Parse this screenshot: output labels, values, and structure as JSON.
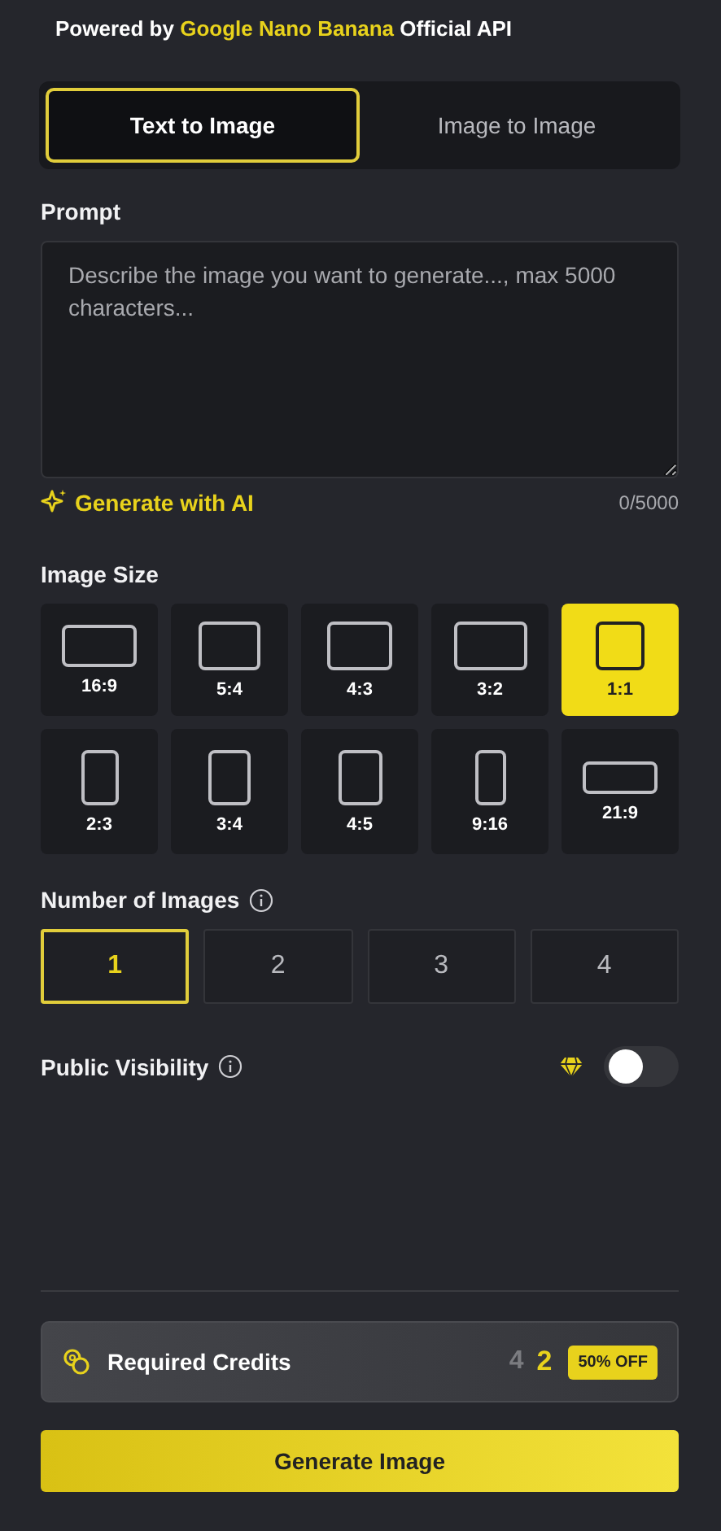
{
  "powered_by": {
    "prefix": "Powered by",
    "brand": "Google Nano Banana",
    "suffix": "Official API"
  },
  "mode_tabs": [
    {
      "label": "Text to Image",
      "selected": true
    },
    {
      "label": "Image to Image",
      "selected": false
    }
  ],
  "prompt": {
    "label": "Prompt",
    "placeholder": "Describe the image you want to generate..., max 5000 characters...",
    "generate_with_ai": "Generate with AI",
    "counter": "0/5000"
  },
  "image_size": {
    "label": "Image Size",
    "options": [
      {
        "label": "16:9",
        "selected": false
      },
      {
        "label": "5:4",
        "selected": false
      },
      {
        "label": "4:3",
        "selected": false
      },
      {
        "label": "3:2",
        "selected": false
      },
      {
        "label": "1:1",
        "selected": true
      },
      {
        "label": "2:3",
        "selected": false
      },
      {
        "label": "3:4",
        "selected": false
      },
      {
        "label": "4:5",
        "selected": false
      },
      {
        "label": "9:16",
        "selected": false
      },
      {
        "label": "21:9",
        "selected": false
      }
    ]
  },
  "number_of_images": {
    "label": "Number of Images",
    "options": [
      {
        "label": "1",
        "selected": true
      },
      {
        "label": "2",
        "selected": false
      },
      {
        "label": "3",
        "selected": false
      },
      {
        "label": "4",
        "selected": false
      }
    ]
  },
  "public_visibility": {
    "label": "Public Visibility",
    "on": false
  },
  "credits": {
    "label": "Required Credits",
    "original": "4",
    "price": "2",
    "badge": "50% OFF"
  },
  "generate_button": "Generate Image"
}
